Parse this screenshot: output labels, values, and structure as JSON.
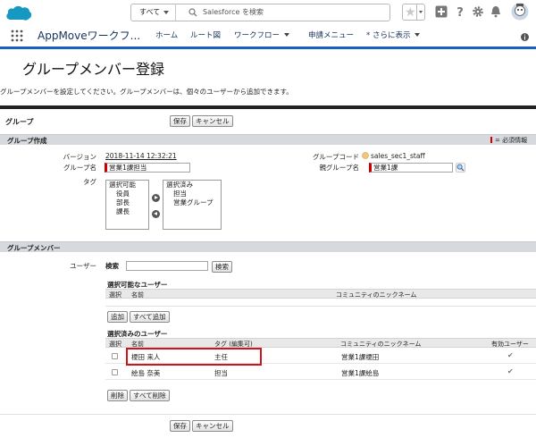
{
  "header": {
    "search_scope": "すべて",
    "search_placeholder": "Salesforce を検索",
    "colors": {
      "brand": "#1798c1",
      "nav_accent": "#1b5fc1",
      "required": "#c00000",
      "highlight": "#d0141c"
    }
  },
  "nav": {
    "app_name": "AppMoveワークフ...",
    "items": [
      "ホーム",
      "ルート図",
      "ワークフロー",
      "申請メニュー",
      "* さらに表示"
    ]
  },
  "page": {
    "title": "グループメンバー登録",
    "description": "グループメンバーを設定してください。グループメンバーは、個々のユーザーから追加できます。"
  },
  "group_section": {
    "label": "グループ",
    "save": "保存",
    "cancel": "キャンセル"
  },
  "group_create": {
    "header": "グループ作成",
    "required_info": "= 必須情報",
    "version_label": "バージョン",
    "version_value": "2018-11-14 12:32:21",
    "group_name_label": "グループ名",
    "group_name_value": "営業1課担当",
    "tag_label": "タグ",
    "available_header": "選択可能",
    "available_items": [
      "役員",
      "部長",
      "課長"
    ],
    "selected_header": "選択済み",
    "selected_items": [
      "担当",
      "営業グループ"
    ],
    "group_code_label": "グループコード",
    "group_code_value": "sales_sec1_staff",
    "parent_group_label": "親グループ名",
    "parent_group_value": "営業1課"
  },
  "members": {
    "header": "グループメンバー",
    "user_label": "ユーザー",
    "search_label": "検索",
    "search_button": "検索",
    "available_title": "選択可能なユーザー",
    "available_columns": [
      "選択",
      "名前",
      "コミュニティのニックネーム"
    ],
    "add_button": "追加",
    "add_all_button": "すべて追加",
    "selected_title": "選択済みのユーザー",
    "selected_columns": [
      "選択",
      "名前",
      "タグ (編集可)",
      "コミュニティのニックネーム",
      "有効ユーザー"
    ],
    "rows": [
      {
        "name": "榎田 来人",
        "tag": "主任",
        "nickname": "営業1課榎田"
      },
      {
        "name": "絵島 奈美",
        "tag": "担当",
        "nickname": "営業1課絵島"
      }
    ],
    "delete_button": "削除",
    "delete_all_button": "すべて削除"
  },
  "footer": {
    "save": "保存",
    "cancel": "キャンセル"
  }
}
